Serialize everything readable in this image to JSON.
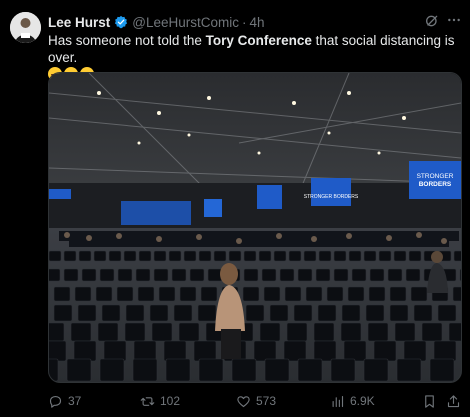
{
  "author": {
    "name": "Lee Hurst",
    "handle": "@LeeHurstComic",
    "separator": "·",
    "time": "4h",
    "verified": true
  },
  "tweet": {
    "text_before": "Has someone not told the ",
    "text_bold": "Tory Conference",
    "text_after": " that social distancing is over.",
    "emojis": [
      "rolling-on-floor-laughing",
      "rolling-on-floor-laughing",
      "rolling-on-floor-laughing"
    ]
  },
  "media": {
    "screen_text_1": "STRONGER",
    "screen_text_2": "BORDERS",
    "screen_text_3": "STRONGER BORDERS"
  },
  "actions": {
    "replies": "37",
    "retweets": "102",
    "likes": "573",
    "views": "6.9K"
  },
  "colors": {
    "background": "#000000",
    "text": "#e7e9ea",
    "muted": "#71767b",
    "verified": "#1d9bf0",
    "screen_blue": "#1f5bc8"
  }
}
